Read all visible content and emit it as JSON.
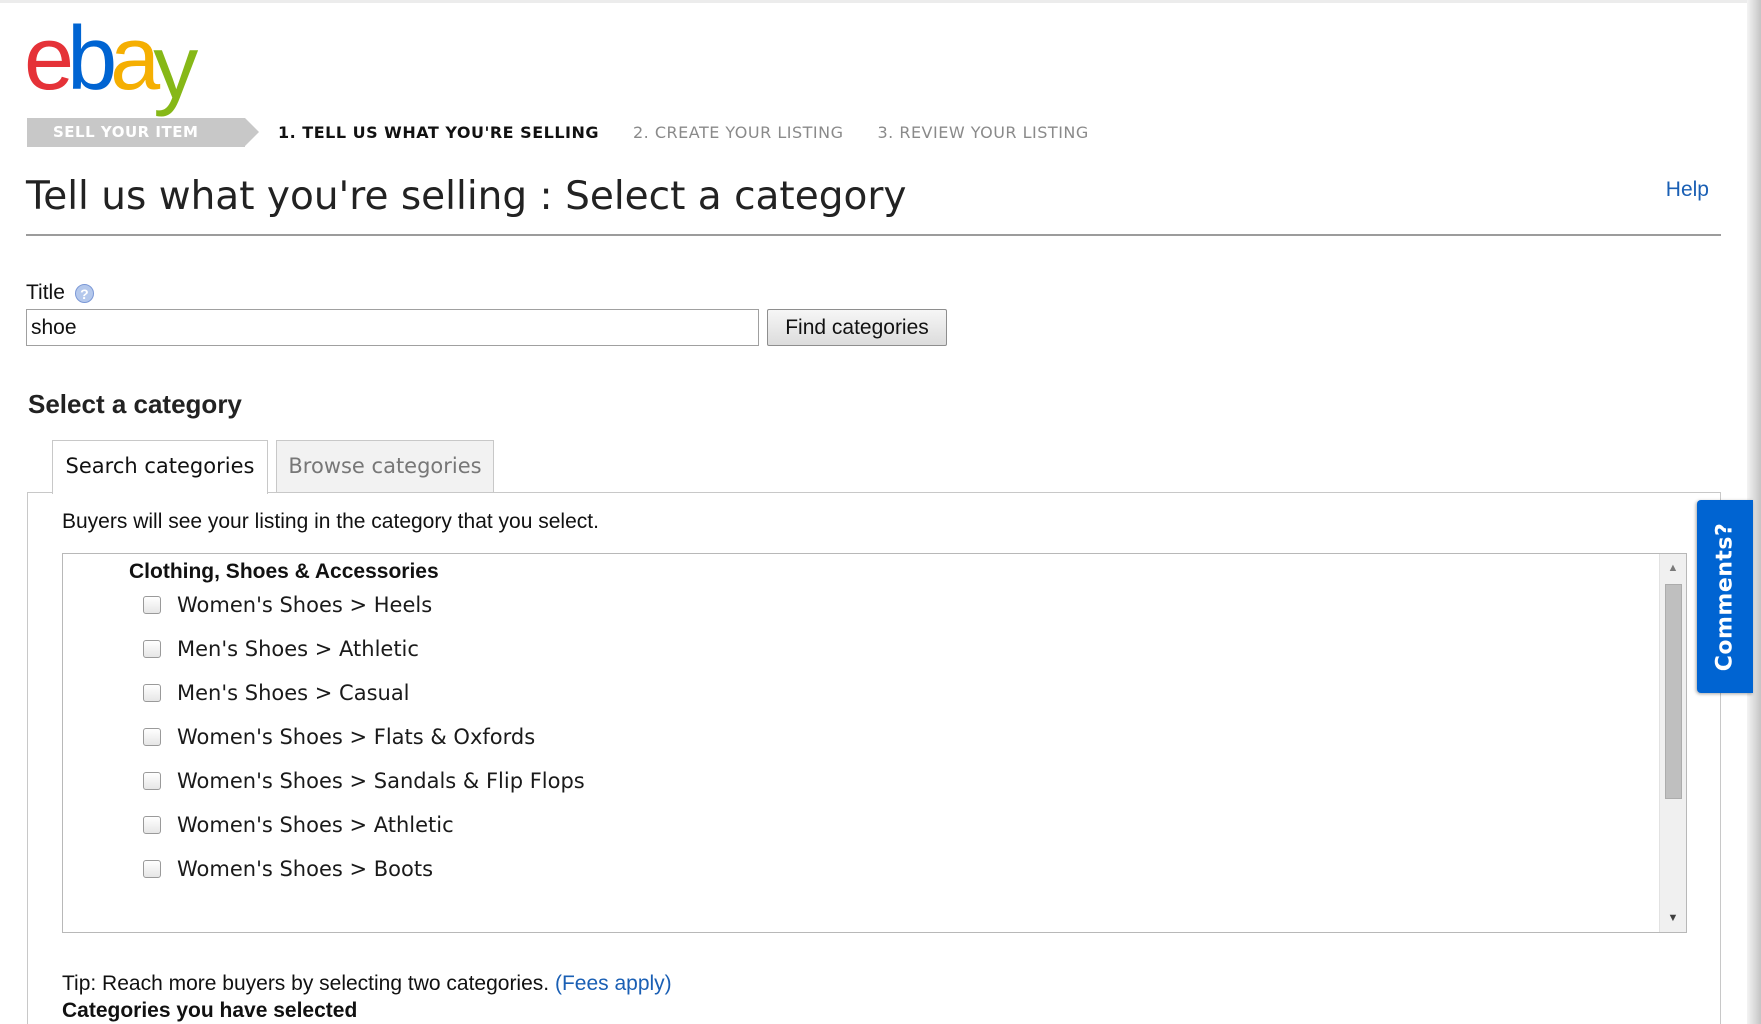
{
  "logo": {
    "letters": [
      "e",
      "b",
      "a",
      "y"
    ],
    "colors": [
      "#e53238",
      "#0064d2",
      "#f5af02",
      "#86b817"
    ]
  },
  "steps": {
    "badge": "SELL YOUR ITEM",
    "items": [
      {
        "label": "1. TELL US WHAT YOU'RE SELLING",
        "active": true
      },
      {
        "label": "2. CREATE YOUR LISTING",
        "active": false
      },
      {
        "label": "3. REVIEW YOUR LISTING",
        "active": false
      }
    ]
  },
  "header": {
    "title": "Tell us what you're selling : Select a category",
    "help": "Help"
  },
  "title_field": {
    "label": "Title",
    "help_icon": "?",
    "value": "shoe",
    "button": "Find categories"
  },
  "category": {
    "heading": "Select a category",
    "tabs": [
      {
        "label": "Search categories",
        "active": true
      },
      {
        "label": "Browse categories",
        "active": false
      }
    ],
    "intro": "Buyers will see your listing in the category that you select.",
    "group": "Clothing, Shoes & Accessories",
    "items": [
      {
        "label": "Women's Shoes > Heels",
        "checked": false
      },
      {
        "label": "Men's Shoes > Athletic",
        "checked": false
      },
      {
        "label": "Men's Shoes > Casual",
        "checked": false
      },
      {
        "label": "Women's Shoes > Flats & Oxfords",
        "checked": false
      },
      {
        "label": "Women's Shoes > Sandals & Flip Flops",
        "checked": false
      },
      {
        "label": "Women's Shoes > Athletic",
        "checked": false
      },
      {
        "label": "Women's Shoes > Boots",
        "checked": false
      }
    ],
    "tip_text": "Tip: Reach more buyers by selecting two categories.",
    "tip_link": "(Fees apply)",
    "selected_heading": "Categories you have selected"
  },
  "comments": {
    "label": "Comments?",
    "color": "#0064d2"
  },
  "colors": {
    "link": "#1a5fb4",
    "badge_bg": "#c8c8c8"
  }
}
